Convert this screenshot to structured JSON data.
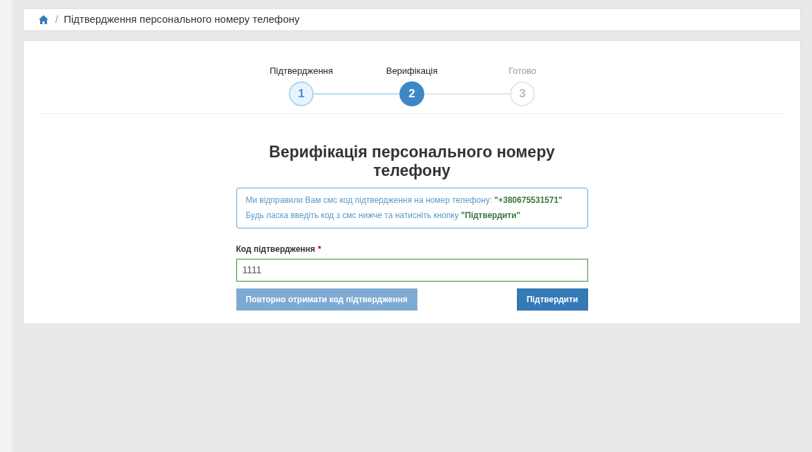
{
  "breadcrumb": {
    "current": "Підтвердження персонального номеру телефону",
    "separator": "/"
  },
  "steps": [
    {
      "label": "Підтвердження",
      "number": "1",
      "completed": true,
      "selected": false
    },
    {
      "label": "Верифікація",
      "number": "2",
      "completed": false,
      "selected": true
    },
    {
      "label": "Готово",
      "number": "3",
      "completed": false,
      "selected": false
    }
  ],
  "title": "Верифікація персонального номеру телефону",
  "info": [
    "Ми відправили Вам смс код підтвердження на номер телефону: **\"+380675531571\"**",
    "Будь ласка введіть код з смс нижче та натисніть кнопку **\"Підтвердити\"**"
  ],
  "field": {
    "label": "Код підтвердження",
    "required_mark": "*",
    "value": "1111"
  },
  "buttons": [
    {
      "label": "Повторно отримати код підтвердження",
      "kind": "secondary",
      "disabled": true
    },
    {
      "label": "Підтвердити",
      "kind": "primary",
      "disabled": false
    }
  ]
}
